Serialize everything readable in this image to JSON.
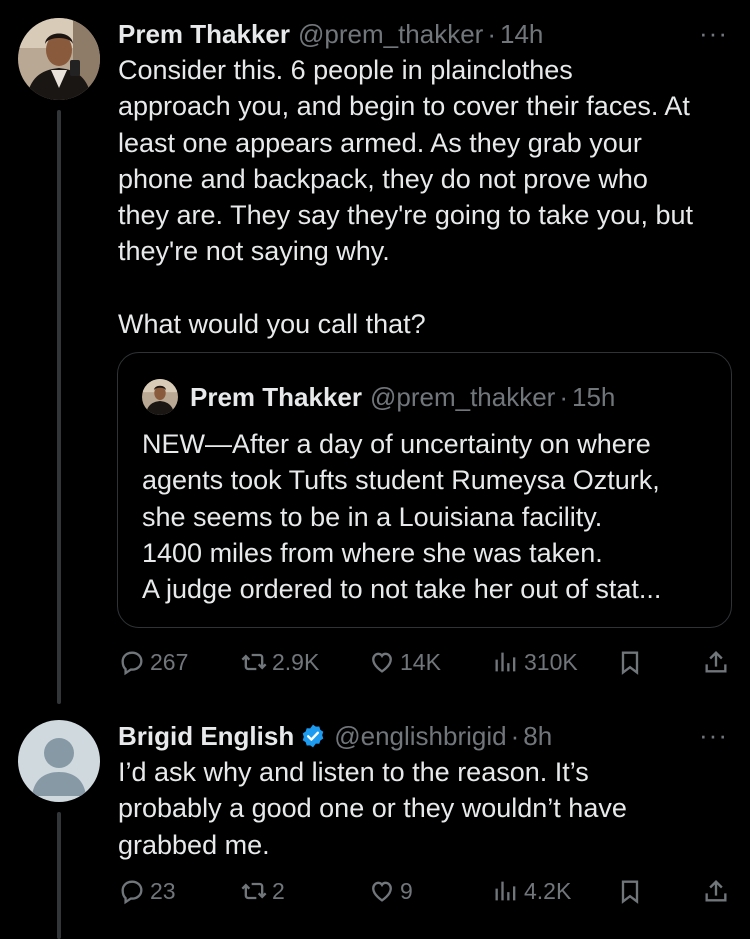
{
  "tweet1": {
    "name": "Prem Thakker",
    "handle": "@prem_thakker",
    "sep": "·",
    "time": "14h",
    "more": "···",
    "text": "Consider this. 6 people in plainclothes\napproach you, and begin to cover their faces. At\nleast one appears armed. As they grab your\nphone and backpack, they do not prove who\nthey are. They say they're going to take you, but\nthey're not saying why.\n\nWhat would you call that?",
    "quote": {
      "name": "Prem Thakker",
      "handle": "@prem_thakker",
      "sep": "·",
      "time": "15h",
      "text": "NEW—After a day of uncertainty on where\nagents took Tufts student Rumeysa Ozturk,\nshe seems to be in a Louisiana facility.\n1400 miles from where she was taken.\nA judge ordered to not take her out of stat..."
    },
    "actions": {
      "replies": "267",
      "reposts": "2.9K",
      "likes": "14K",
      "views": "310K"
    }
  },
  "tweet2": {
    "name": "Brigid English",
    "handle": "@englishbrigid",
    "sep": "·",
    "time": "8h",
    "more": "···",
    "verified": true,
    "text": "I’d ask why and listen to the reason. It’s\nprobably a good one or they wouldn’t have\ngrabbed me.",
    "actions": {
      "replies": "23",
      "reposts": "2",
      "likes": "9",
      "views": "4.2K"
    }
  },
  "colors": {
    "background": "#000000",
    "text": "#e7e9ea",
    "muted": "#71767b",
    "border": "#2f3336",
    "verified": "#1d9bf0"
  }
}
